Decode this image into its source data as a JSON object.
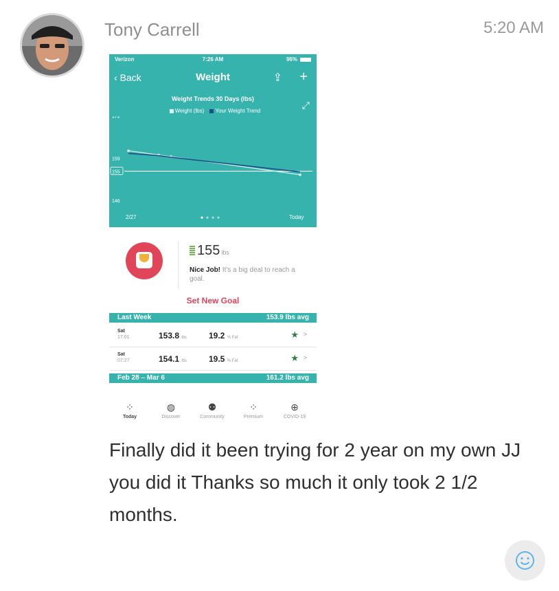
{
  "post": {
    "author": "Tony Carrell",
    "time": "5:20 AM",
    "message": "Finally did it been trying for 2 year on my own JJ you did it Thanks so much it only took 2 1/2 months."
  },
  "screenshot": {
    "status": {
      "carrier": "Verizon",
      "clock": "7:26 AM",
      "battery": "96%"
    },
    "nav": {
      "back": "Back",
      "title": "Weight"
    },
    "chart_data": {
      "type": "line",
      "title": "Weight Trends 30 Days (lbs)",
      "legend": [
        "Weight (lbs)",
        "Your Weight Trend"
      ],
      "y_ticks": [
        172,
        159,
        155,
        146
      ],
      "x_labels": [
        "2/27",
        "Today"
      ],
      "ylim": [
        146,
        172
      ],
      "series": [
        {
          "name": "Weight (lbs)",
          "values": [
            161.3,
            160.0,
            159.5,
            153.9
          ]
        },
        {
          "name": "Your Weight Trend",
          "values": [
            160.5,
            159.8,
            159.3,
            154.8
          ]
        }
      ],
      "goal_line": 155
    },
    "goal": {
      "value": "155",
      "unit": "lbs",
      "nice_bold": "Nice Job!",
      "nice_rest": " It's a big deal to reach a goal.",
      "set_new_goal": "Set New Goal"
    },
    "sections": [
      {
        "label": "Last Week",
        "avg": "153.9 lbs avg",
        "rows": [
          {
            "day": "Sat",
            "clock": "17:01",
            "weight": "153.8",
            "weight_unit": "lbs",
            "fat": "19.2",
            "fat_unit": "% Fat"
          },
          {
            "day": "Sat",
            "clock": "07:27",
            "weight": "154.1",
            "weight_unit": "lbs",
            "fat": "19.5",
            "fat_unit": "% Fat"
          }
        ]
      },
      {
        "label": "Feb 28 – Mar 6",
        "avg": "161.2 lbs avg"
      }
    ],
    "tabs": [
      {
        "label": "Today",
        "icon": "dots-icon"
      },
      {
        "label": "Discover",
        "icon": "compass-icon"
      },
      {
        "label": "Community",
        "icon": "community-icon"
      },
      {
        "label": "Premium",
        "icon": "premium-icon"
      },
      {
        "label": "COVID-19",
        "icon": "plus-circle-icon"
      }
    ]
  },
  "colors": {
    "teal": "#37b3ad",
    "accent": "#e0455a",
    "star": "#2f7d3f"
  }
}
